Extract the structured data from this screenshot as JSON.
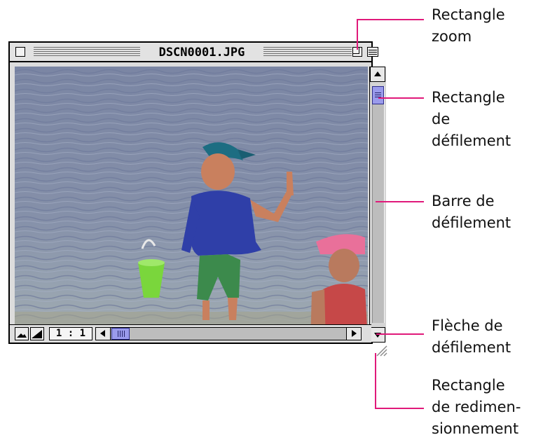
{
  "window": {
    "title": "DSCN0001.JPG",
    "zoom_level": "1 : 1"
  },
  "icons": {
    "close": "close-box-icon",
    "zoom": "zoom-box-icon",
    "collapse": "collapse-box-icon",
    "scroll_up": "arrow-up-icon",
    "scroll_down": "arrow-down-icon",
    "scroll_left": "arrow-left-icon",
    "scroll_right": "arrow-right-icon",
    "small_image": "mountain-small-icon",
    "large_image": "mountain-large-icon",
    "resize": "resize-grip-icon"
  },
  "annotations": [
    {
      "id": "zoom",
      "lines": [
        "Rectangle",
        "zoom"
      ]
    },
    {
      "id": "scroll-box",
      "lines": [
        "Rectangle",
        "de",
        "défilement"
      ]
    },
    {
      "id": "scroll-bar",
      "lines": [
        "Barre de",
        "défilement"
      ]
    },
    {
      "id": "scroll-arrow",
      "lines": [
        "Flèche de",
        "défilement"
      ]
    },
    {
      "id": "resize",
      "lines": [
        "Rectangle",
        "de redimen-",
        "sionnement"
      ]
    }
  ],
  "colors": {
    "callout": "#e0197a",
    "scroll_thumb": "#9a9bec"
  }
}
